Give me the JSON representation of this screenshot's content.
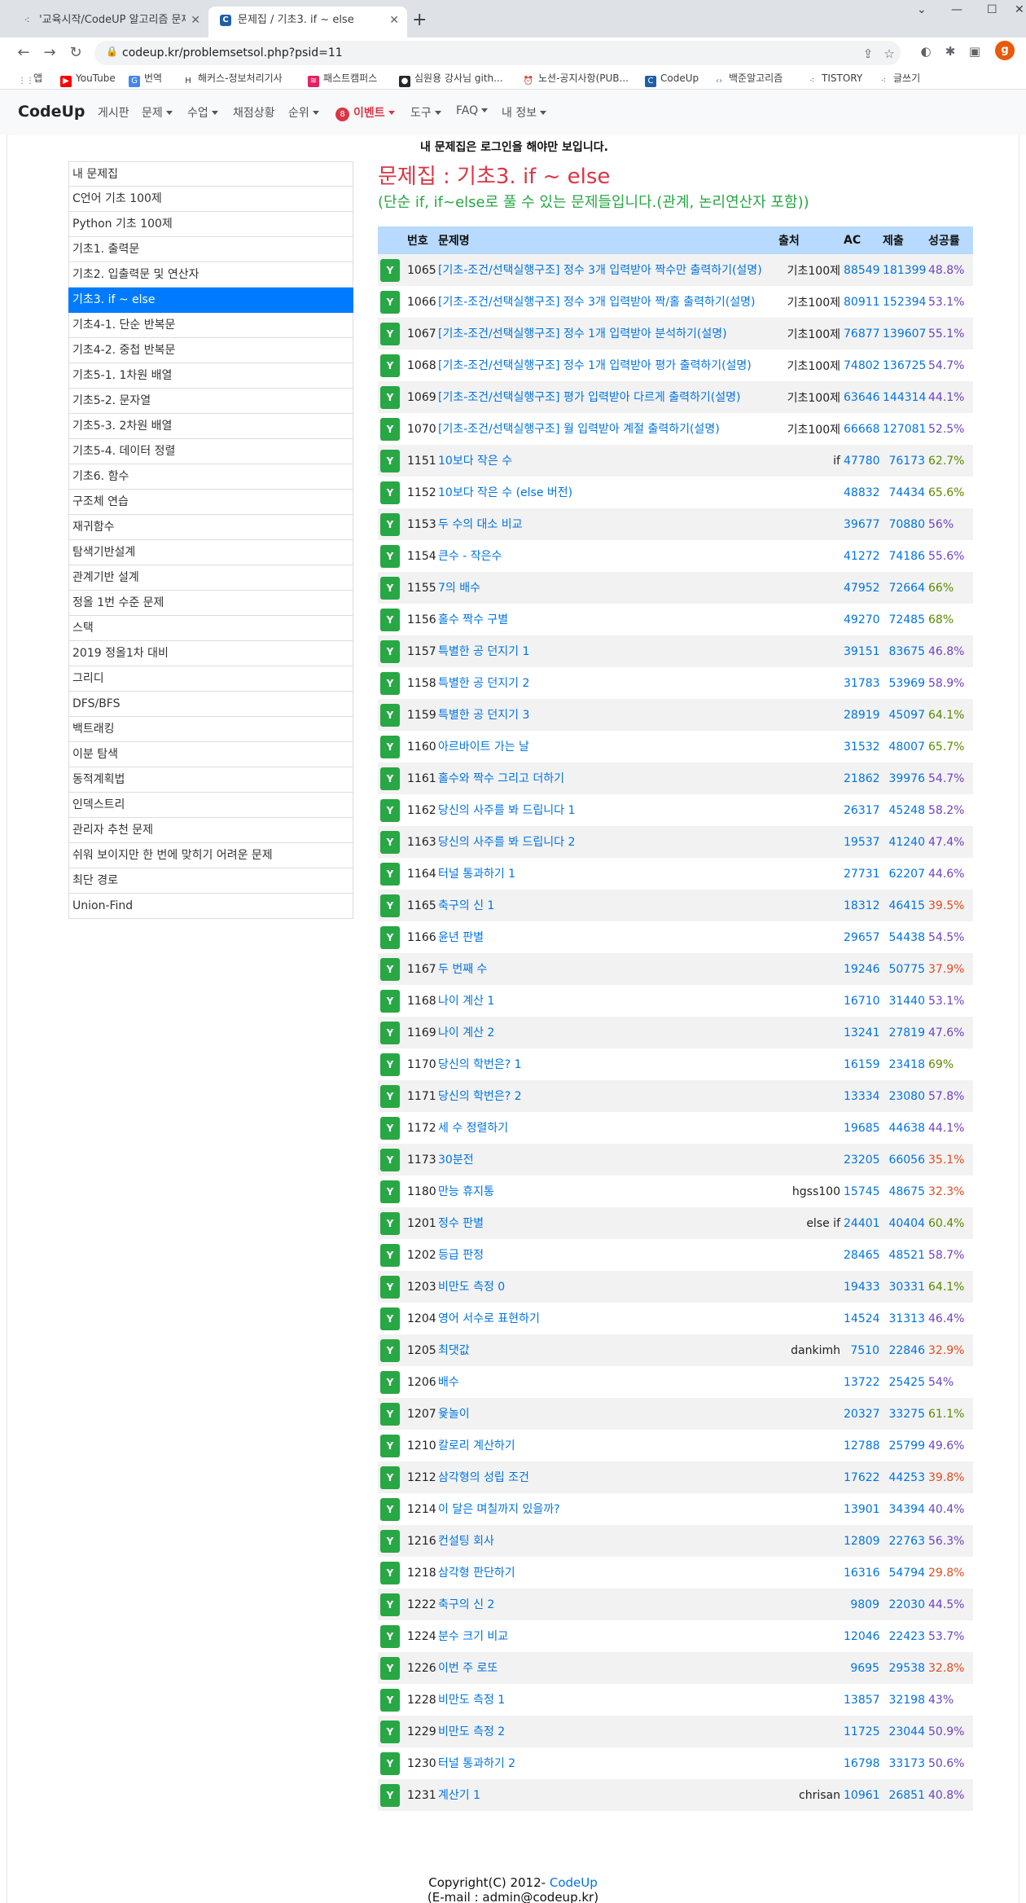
{
  "browser": {
    "tabs": [
      {
        "title": "'교육시작/CodeUP 알고리즘 문제",
        "active": false
      },
      {
        "title": "문제집 / 기초3. if ~ else",
        "active": true
      }
    ],
    "url": "codeup.kr/problemsetsol.php?psid=11",
    "profile_initial": "g",
    "bookmarks": [
      {
        "label": "앱",
        "icon": "apps-icon",
        "color": "#5f6368"
      },
      {
        "label": "YouTube",
        "icon": "youtube-icon",
        "color": "#ff0000"
      },
      {
        "label": "번역",
        "icon": "translate-icon",
        "color": "#4285f4"
      },
      {
        "label": "해커스-정보처리기사",
        "icon": "hackers-icon",
        "color": "#333333"
      },
      {
        "label": "패스트캠퍼스",
        "icon": "fastcampus-icon",
        "color": "#e91e63"
      },
      {
        "label": "심원용 강사님 gith...",
        "icon": "github-icon",
        "color": "#24292e"
      },
      {
        "label": "노션-공지사항(PUB...",
        "icon": "alarm-icon",
        "color": "#d93025"
      },
      {
        "label": "CodeUp",
        "icon": "codeup-icon",
        "color": "#1f5ea8"
      },
      {
        "label": "백준알고리즘",
        "icon": "code-icon",
        "color": "#3a7bd5"
      },
      {
        "label": "TISTORY",
        "icon": "tistory-icon",
        "color": "#333333"
      },
      {
        "label": "글쓰기",
        "icon": "tistory-icon",
        "color": "#333333"
      }
    ]
  },
  "navbar": {
    "brand": "CodeUp",
    "items": [
      "게시판",
      "문제",
      "수업",
      "채점상황",
      "순위",
      "이벤트",
      "도구",
      "FAQ",
      "내 정보"
    ],
    "event_count": "8"
  },
  "sidebar": {
    "items": [
      "내 문제집",
      "C언어 기초 100제",
      "Python 기초 100제",
      "기초1. 출력문",
      "기초2. 입출력문 및 연산자",
      "기초3. if ~ else",
      "기초4-1. 단순 반복문",
      "기초4-2. 중첩 반복문",
      "기초5-1. 1차원 배열",
      "기초5-2. 문자열",
      "기초5-3. 2차원 배열",
      "기초5-4. 데이터 정렬",
      "기초6. 함수",
      "구조체 연습",
      "재귀함수",
      "탐색기반설계",
      "관계기반 설계",
      "정올 1번 수준 문제",
      "스택",
      "2019 정올1차 대비",
      "그리디",
      "DFS/BFS",
      "백트래킹",
      "이분 탐색",
      "동적계획법",
      "인덱스트리",
      "관리자 추천 문제",
      "쉬워 보이지만 한 번에 맞히기 어려운 문제",
      "최단 경로",
      "Union-Find"
    ],
    "active_index": 5
  },
  "main": {
    "notice": "내 문제집은 로그인을 해야만 보입니다.",
    "title": "문제집 : 기초3. if ~ else",
    "description": "(단순 if, if~else로 풀 수 있는 문제들입니다.(관계, 논리연산자 포함))",
    "headers": [
      "",
      "번호",
      "문제명",
      "출처",
      "AC",
      "제출",
      "성공률"
    ],
    "badge": "Y",
    "rows": [
      {
        "num": "1065",
        "name": "[기초-조건/선택실행구조] 정수 3개 입력받아 짝수만 출력하기(설명)",
        "src": "기초100제",
        "ac": "88549",
        "sub": "181399",
        "rate": "48.8%",
        "rc": "purple"
      },
      {
        "num": "1066",
        "name": "[기초-조건/선택실행구조] 정수 3개 입력받아 짝/홀 출력하기(설명)",
        "src": "기초100제",
        "ac": "80911",
        "sub": "152394",
        "rate": "53.1%",
        "rc": "purple"
      },
      {
        "num": "1067",
        "name": "[기초-조건/선택실행구조] 정수 1개 입력받아 분석하기(설명)",
        "src": "기초100제",
        "ac": "76877",
        "sub": "139607",
        "rate": "55.1%",
        "rc": "purple"
      },
      {
        "num": "1068",
        "name": "[기초-조건/선택실행구조] 정수 1개 입력받아 평가 출력하기(설명)",
        "src": "기초100제",
        "ac": "74802",
        "sub": "136725",
        "rate": "54.7%",
        "rc": "purple"
      },
      {
        "num": "1069",
        "name": "[기초-조건/선택실행구조] 평가 입력받아 다르게 출력하기(설명)",
        "src": "기초100제",
        "ac": "63646",
        "sub": "144314",
        "rate": "44.1%",
        "rc": "purple"
      },
      {
        "num": "1070",
        "name": "[기초-조건/선택실행구조] 월 입력받아 계절 출력하기(설명)",
        "src": "기초100제",
        "ac": "66668",
        "sub": "127081",
        "rate": "52.5%",
        "rc": "purple"
      },
      {
        "num": "1151",
        "name": "10보다 작은 수",
        "src": "if",
        "ac": "47780",
        "sub": "76173",
        "rate": "62.7%",
        "rc": "green"
      },
      {
        "num": "1152",
        "name": "10보다 작은 수 (else 버전)",
        "src": "",
        "ac": "48832",
        "sub": "74434",
        "rate": "65.6%",
        "rc": "green"
      },
      {
        "num": "1153",
        "name": "두 수의 대소 비교",
        "src": "",
        "ac": "39677",
        "sub": "70880",
        "rate": "56%",
        "rc": "purple"
      },
      {
        "num": "1154",
        "name": "큰수 - 작은수",
        "src": "",
        "ac": "41272",
        "sub": "74186",
        "rate": "55.6%",
        "rc": "purple"
      },
      {
        "num": "1155",
        "name": "7의 배수",
        "src": "",
        "ac": "47952",
        "sub": "72664",
        "rate": "66%",
        "rc": "green"
      },
      {
        "num": "1156",
        "name": "홀수 짝수 구별",
        "src": "",
        "ac": "49270",
        "sub": "72485",
        "rate": "68%",
        "rc": "green"
      },
      {
        "num": "1157",
        "name": "특별한 공 던지기 1",
        "src": "",
        "ac": "39151",
        "sub": "83675",
        "rate": "46.8%",
        "rc": "purple"
      },
      {
        "num": "1158",
        "name": "특별한 공 던지기 2",
        "src": "",
        "ac": "31783",
        "sub": "53969",
        "rate": "58.9%",
        "rc": "purple"
      },
      {
        "num": "1159",
        "name": "특별한 공 던지기 3",
        "src": "",
        "ac": "28919",
        "sub": "45097",
        "rate": "64.1%",
        "rc": "green"
      },
      {
        "num": "1160",
        "name": "아르바이트 가는 날",
        "src": "",
        "ac": "31532",
        "sub": "48007",
        "rate": "65.7%",
        "rc": "green"
      },
      {
        "num": "1161",
        "name": "홀수와 짝수 그리고 더하기",
        "src": "",
        "ac": "21862",
        "sub": "39976",
        "rate": "54.7%",
        "rc": "purple"
      },
      {
        "num": "1162",
        "name": "당신의 사주를 봐 드립니다 1",
        "src": "",
        "ac": "26317",
        "sub": "45248",
        "rate": "58.2%",
        "rc": "purple"
      },
      {
        "num": "1163",
        "name": "당신의 사주를 봐 드립니다 2",
        "src": "",
        "ac": "19537",
        "sub": "41240",
        "rate": "47.4%",
        "rc": "purple"
      },
      {
        "num": "1164",
        "name": "터널 통과하기 1",
        "src": "",
        "ac": "27731",
        "sub": "62207",
        "rate": "44.6%",
        "rc": "purple"
      },
      {
        "num": "1165",
        "name": "축구의 신 1",
        "src": "",
        "ac": "18312",
        "sub": "46415",
        "rate": "39.5%",
        "rc": "red"
      },
      {
        "num": "1166",
        "name": "윤년 판별",
        "src": "",
        "ac": "29657",
        "sub": "54438",
        "rate": "54.5%",
        "rc": "purple"
      },
      {
        "num": "1167",
        "name": "두 번째 수",
        "src": "",
        "ac": "19246",
        "sub": "50775",
        "rate": "37.9%",
        "rc": "red"
      },
      {
        "num": "1168",
        "name": "나이 계산 1",
        "src": "",
        "ac": "16710",
        "sub": "31440",
        "rate": "53.1%",
        "rc": "purple"
      },
      {
        "num": "1169",
        "name": "나이 계산 2",
        "src": "",
        "ac": "13241",
        "sub": "27819",
        "rate": "47.6%",
        "rc": "purple"
      },
      {
        "num": "1170",
        "name": "당신의 학번은? 1",
        "src": "",
        "ac": "16159",
        "sub": "23418",
        "rate": "69%",
        "rc": "green"
      },
      {
        "num": "1171",
        "name": "당신의 학번은? 2",
        "src": "",
        "ac": "13334",
        "sub": "23080",
        "rate": "57.8%",
        "rc": "purple"
      },
      {
        "num": "1172",
        "name": "세 수 정렬하기",
        "src": "",
        "ac": "19685",
        "sub": "44638",
        "rate": "44.1%",
        "rc": "purple"
      },
      {
        "num": "1173",
        "name": "30분전",
        "src": "",
        "ac": "23205",
        "sub": "66056",
        "rate": "35.1%",
        "rc": "red"
      },
      {
        "num": "1180",
        "name": "만능 휴지통",
        "src": "hgss100",
        "ac": "15745",
        "sub": "48675",
        "rate": "32.3%",
        "rc": "red"
      },
      {
        "num": "1201",
        "name": "정수 판별",
        "src": "else if",
        "ac": "24401",
        "sub": "40404",
        "rate": "60.4%",
        "rc": "green"
      },
      {
        "num": "1202",
        "name": "등급 판정",
        "src": "",
        "ac": "28465",
        "sub": "48521",
        "rate": "58.7%",
        "rc": "purple"
      },
      {
        "num": "1203",
        "name": "비만도 측정 0",
        "src": "",
        "ac": "19433",
        "sub": "30331",
        "rate": "64.1%",
        "rc": "green"
      },
      {
        "num": "1204",
        "name": "영어 서수로 표현하기",
        "src": "",
        "ac": "14524",
        "sub": "31313",
        "rate": "46.4%",
        "rc": "purple"
      },
      {
        "num": "1205",
        "name": "최댓값",
        "src": "dankimh",
        "ac": "7510",
        "sub": "22846",
        "rate": "32.9%",
        "rc": "red"
      },
      {
        "num": "1206",
        "name": "배수",
        "src": "",
        "ac": "13722",
        "sub": "25425",
        "rate": "54%",
        "rc": "purple"
      },
      {
        "num": "1207",
        "name": "윷놀이",
        "src": "",
        "ac": "20327",
        "sub": "33275",
        "rate": "61.1%",
        "rc": "green"
      },
      {
        "num": "1210",
        "name": "칼로리 계산하기",
        "src": "",
        "ac": "12788",
        "sub": "25799",
        "rate": "49.6%",
        "rc": "purple"
      },
      {
        "num": "1212",
        "name": "삼각형의 성립 조건",
        "src": "",
        "ac": "17622",
        "sub": "44253",
        "rate": "39.8%",
        "rc": "red"
      },
      {
        "num": "1214",
        "name": "이 달은 며칠까지 있을까?",
        "src": "",
        "ac": "13901",
        "sub": "34394",
        "rate": "40.4%",
        "rc": "purple"
      },
      {
        "num": "1216",
        "name": "컨설팅 회사",
        "src": "",
        "ac": "12809",
        "sub": "22763",
        "rate": "56.3%",
        "rc": "purple"
      },
      {
        "num": "1218",
        "name": "삼각형 판단하기",
        "src": "",
        "ac": "16316",
        "sub": "54794",
        "rate": "29.8%",
        "rc": "red"
      },
      {
        "num": "1222",
        "name": "축구의 신 2",
        "src": "",
        "ac": "9809",
        "sub": "22030",
        "rate": "44.5%",
        "rc": "purple"
      },
      {
        "num": "1224",
        "name": "분수 크기 비교",
        "src": "",
        "ac": "12046",
        "sub": "22423",
        "rate": "53.7%",
        "rc": "purple"
      },
      {
        "num": "1226",
        "name": "이번 주 로또",
        "src": "",
        "ac": "9695",
        "sub": "29538",
        "rate": "32.8%",
        "rc": "red"
      },
      {
        "num": "1228",
        "name": "비만도 측정 1",
        "src": "",
        "ac": "13857",
        "sub": "32198",
        "rate": "43%",
        "rc": "purple"
      },
      {
        "num": "1229",
        "name": "비만도 측정 2",
        "src": "",
        "ac": "11725",
        "sub": "23044",
        "rate": "50.9%",
        "rc": "purple"
      },
      {
        "num": "1230",
        "name": "터널 통과하기 2",
        "src": "",
        "ac": "16798",
        "sub": "33173",
        "rate": "50.6%",
        "rc": "purple"
      },
      {
        "num": "1231",
        "name": "계산기 1",
        "src": "chrisan",
        "ac": "10961",
        "sub": "26851",
        "rate": "40.8%",
        "rc": "purple"
      }
    ]
  },
  "footer": {
    "copyright": "Copyright(C) 2012-",
    "site": "CodeUp",
    "email": "E-mail : admin@codeup.kr"
  }
}
